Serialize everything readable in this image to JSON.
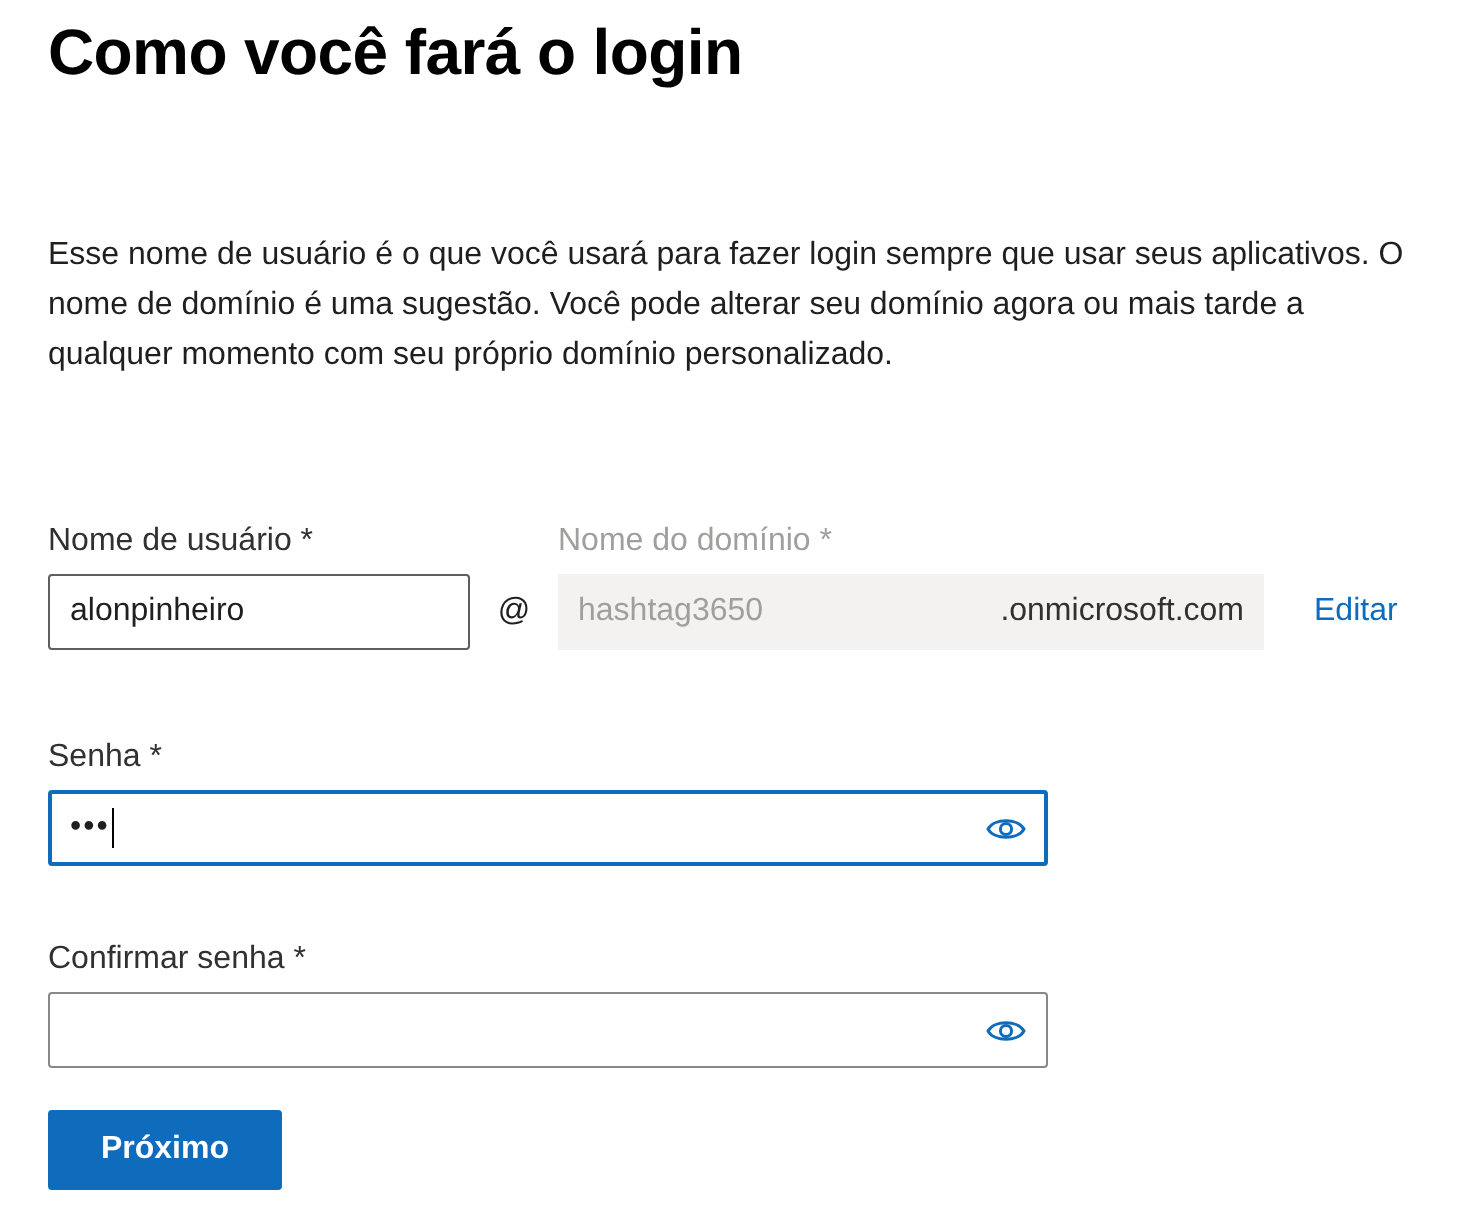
{
  "title": "Como você fará o login",
  "description": "Esse nome de usuário é o que você usará para fazer login sempre que usar seus aplicativos. O nome de domínio é uma sugestão. Você pode alterar seu domínio agora ou mais tarde a qualquer momento com seu próprio domínio personalizado.",
  "username": {
    "label": "Nome de usuário *",
    "value": "alonpinheiro"
  },
  "at": "@",
  "domain": {
    "label": "Nome do domínio *",
    "value": "hashtag3650",
    "suffix": ".onmicrosoft.com",
    "disabled": true
  },
  "edit_link": "Editar",
  "password": {
    "label": "Senha *",
    "value": "•••",
    "focused": true
  },
  "confirm_password": {
    "label": "Confirmar senha *",
    "focused": false
  },
  "next_button": "Próximo"
}
